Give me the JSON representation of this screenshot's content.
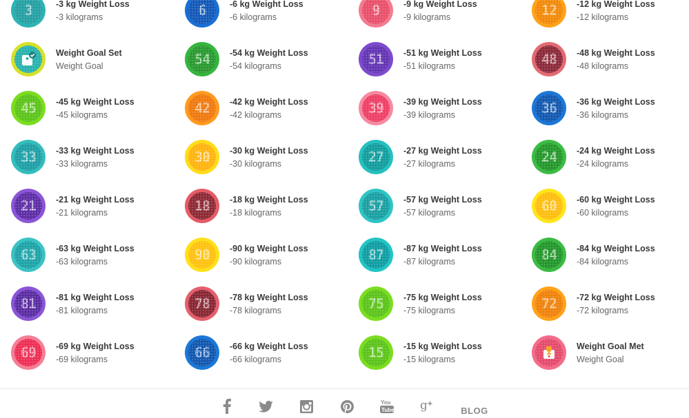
{
  "badges": [
    [
      {
        "title": "-3 kg Weight Loss",
        "subtitle": "-3 kilograms",
        "number": "3",
        "color": "#2eb3b3",
        "inner": "#26a0a3",
        "icon": "number-medal"
      },
      {
        "title": "-6 kg Weight Loss",
        "subtitle": "-6 kilograms",
        "number": "6",
        "color": "#1a6fd6",
        "inner": "#1459b8",
        "icon": "number-medal"
      },
      {
        "title": "-9 kg Weight Loss",
        "subtitle": "-9 kilograms",
        "number": "9",
        "color": "#f27c8f",
        "inner": "#e8506b",
        "icon": "number-medal"
      },
      {
        "title": "-12 kg Weight Loss",
        "subtitle": "-12 kilograms",
        "number": "12",
        "color": "#ffa21a",
        "inner": "#f18a0a",
        "icon": "number-medal"
      }
    ],
    [
      {
        "title": "Weight Goal Set",
        "subtitle": "Weight Goal",
        "number": "",
        "color": "#d7e02a",
        "inner": "#2ab3ae",
        "icon": "scale-check-icon"
      },
      {
        "title": "-54 kg Weight Loss",
        "subtitle": "-54 kilograms",
        "number": "54",
        "color": "#36b53f",
        "inner": "#2a9a30",
        "icon": "number-medal"
      },
      {
        "title": "-51 kg Weight Loss",
        "subtitle": "-51 kilograms",
        "number": "51",
        "color": "#7c4bcc",
        "inner": "#6435b3",
        "icon": "number-medal"
      },
      {
        "title": "-48 kg Weight Loss",
        "subtitle": "-48 kilograms",
        "number": "48",
        "color": "#e26a73",
        "inner": "#8c2a3b",
        "icon": "number-medal"
      }
    ],
    [
      {
        "title": "-45 kg Weight Loss",
        "subtitle": "-45 kilograms",
        "number": "45",
        "color": "#7bdd20",
        "inner": "#5cc41a",
        "icon": "number-medal"
      },
      {
        "title": "-42 kg Weight Loss",
        "subtitle": "-42 kilograms",
        "number": "42",
        "color": "#ff9a1f",
        "inner": "#ef7a10",
        "icon": "number-medal"
      },
      {
        "title": "-39 kg Weight Loss",
        "subtitle": "-39 kilograms",
        "number": "39",
        "color": "#f58aa0",
        "inner": "#ee3f66",
        "icon": "number-medal"
      },
      {
        "title": "-36 kg Weight Loss",
        "subtitle": "-36 kilograms",
        "number": "36",
        "color": "#1b78d8",
        "inner": "#1258b0",
        "icon": "number-medal"
      }
    ],
    [
      {
        "title": "-33 kg Weight Loss",
        "subtitle": "-33 kilograms",
        "number": "33",
        "color": "#35bdbd",
        "inner": "#1f9fa6",
        "icon": "number-medal"
      },
      {
        "title": "-30 kg Weight Loss",
        "subtitle": "-30 kilograms",
        "number": "30",
        "color": "#ffdc1a",
        "inner": "#ffb40f",
        "icon": "number-medal"
      },
      {
        "title": "-27 kg Weight Loss",
        "subtitle": "-27 kilograms",
        "number": "27",
        "color": "#27c0c0",
        "inner": "#129d9d",
        "icon": "number-medal"
      },
      {
        "title": "-24 kg Weight Loss",
        "subtitle": "-24 kilograms",
        "number": "24",
        "color": "#3cbb45",
        "inner": "#24982b",
        "icon": "number-medal"
      }
    ],
    [
      {
        "title": "-21 kg Weight Loss",
        "subtitle": "-21 kilograms",
        "number": "21",
        "color": "#8a55d6",
        "inner": "#5e2fa6",
        "icon": "number-medal"
      },
      {
        "title": "-18 kg Weight Loss",
        "subtitle": "-18 kilograms",
        "number": "18",
        "color": "#e35c68",
        "inner": "#8e2a35",
        "icon": "number-medal"
      },
      {
        "title": "-57 kg Weight Loss",
        "subtitle": "-57 kilograms",
        "number": "57",
        "color": "#2ec4c4",
        "inner": "#1aa0a3",
        "icon": "number-medal"
      },
      {
        "title": "-60 kg Weight Loss",
        "subtitle": "-60 kilograms",
        "number": "60",
        "color": "#ffe51a",
        "inner": "#ffbe0f",
        "icon": "number-medal"
      }
    ],
    [
      {
        "title": "-63 kg Weight Loss",
        "subtitle": "-63 kilograms",
        "number": "63",
        "color": "#3cc3c3",
        "inner": "#1ea4a8",
        "icon": "number-medal"
      },
      {
        "title": "-90 kg Weight Loss",
        "subtitle": "-90 kilograms",
        "number": "90",
        "color": "#ffe01a",
        "inner": "#ffc20f",
        "icon": "number-medal"
      },
      {
        "title": "-87 kg Weight Loss",
        "subtitle": "-87 kilograms",
        "number": "87",
        "color": "#22c4c4",
        "inner": "#0f9ea3",
        "icon": "number-medal"
      },
      {
        "title": "-84 kg Weight Loss",
        "subtitle": "-84 kilograms",
        "number": "84",
        "color": "#3cbb45",
        "inner": "#23972b",
        "icon": "number-medal"
      }
    ],
    [
      {
        "title": "-81 kg Weight Loss",
        "subtitle": "-81 kilograms",
        "number": "81",
        "color": "#8a55d6",
        "inner": "#5b2da3",
        "icon": "number-medal"
      },
      {
        "title": "-78 kg Weight Loss",
        "subtitle": "-78 kilograms",
        "number": "78",
        "color": "#e3606c",
        "inner": "#8a2734",
        "icon": "number-medal"
      },
      {
        "title": "-75 kg Weight Loss",
        "subtitle": "-75 kilograms",
        "number": "75",
        "color": "#7bdd20",
        "inner": "#5cc41a",
        "icon": "number-medal"
      },
      {
        "title": "-72 kg Weight Loss",
        "subtitle": "-72 kilograms",
        "number": "72",
        "color": "#ffa21a",
        "inner": "#f0820c",
        "icon": "number-medal"
      }
    ],
    [
      {
        "title": "-69 kg Weight Loss",
        "subtitle": "-69 kilograms",
        "number": "69",
        "color": "#f57f95",
        "inner": "#ee2f56",
        "icon": "number-medal"
      },
      {
        "title": "-66 kg Weight Loss",
        "subtitle": "-66 kilograms",
        "number": "66",
        "color": "#1b78d8",
        "inner": "#1258b0",
        "icon": "number-medal"
      },
      {
        "title": "-15 kg Weight Loss",
        "subtitle": "-15 kilograms",
        "number": "15",
        "color": "#7bdd20",
        "inner": "#5cc41a",
        "icon": "number-medal"
      },
      {
        "title": "Weight Goal Met",
        "subtitle": "Weight Goal",
        "number": "",
        "color": "#f36c8a",
        "inner": "#e44c6e",
        "icon": "trophy-scale-icon"
      }
    ]
  ],
  "footer": {
    "links": [
      {
        "name": "facebook-icon"
      },
      {
        "name": "twitter-icon"
      },
      {
        "name": "instagram-icon"
      },
      {
        "name": "pinterest-icon"
      },
      {
        "name": "youtube-icon"
      },
      {
        "name": "google-plus-icon"
      }
    ],
    "blog_label": "BLOG"
  }
}
